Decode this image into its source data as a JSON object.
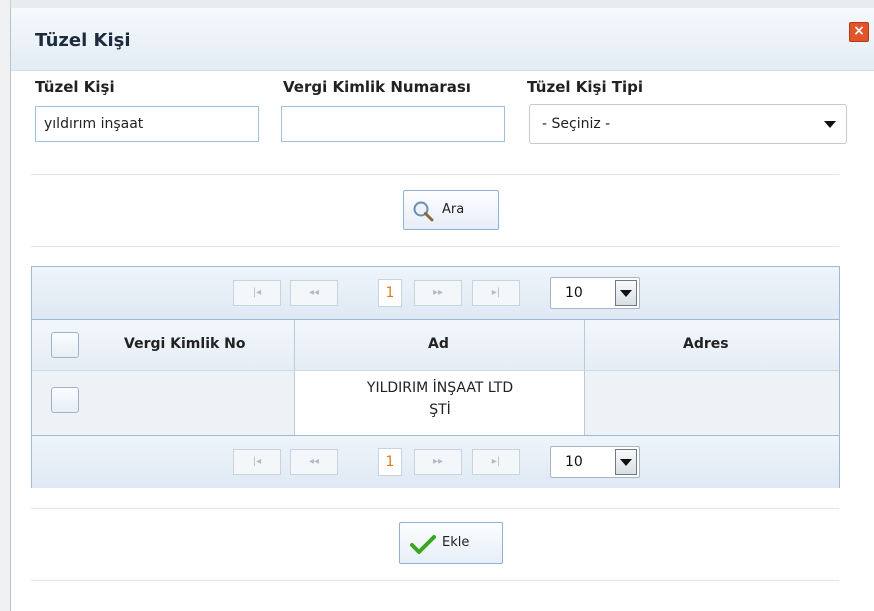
{
  "dialog": {
    "title": "Tüzel Kişi",
    "close_label": "×"
  },
  "form": {
    "name_label": "Tüzel Kişi",
    "name_value": "yıldırım inşaat",
    "tax_label": "Vergi Kimlik Numarası",
    "tax_value": "",
    "type_label": "Tüzel Kişi Tipi",
    "type_selected": "- Seçiniz -"
  },
  "search_button": {
    "label": "Ara",
    "icon": "magnifier-icon"
  },
  "pager": {
    "first": "|◂",
    "prev": "◂◂",
    "current_page": "1",
    "next": "▸▸",
    "last": "▸|",
    "page_size": "10"
  },
  "table": {
    "columns": [
      "Vergi Kimlik No",
      "Ad",
      "Adres"
    ],
    "rows": [
      {
        "vergi_kimlik_no": "",
        "ad_line1": "YILDIRIM İNŞAAT LTD",
        "ad_line2": "ŞTİ",
        "adres": ""
      }
    ]
  },
  "add_button": {
    "label": "Ekle",
    "icon": "checkmark-icon"
  },
  "colors": {
    "accent_border": "#9dbbd8",
    "close_red": "#e2552a",
    "check_green": "#3aa620",
    "page_orange": "#e07a1a"
  }
}
